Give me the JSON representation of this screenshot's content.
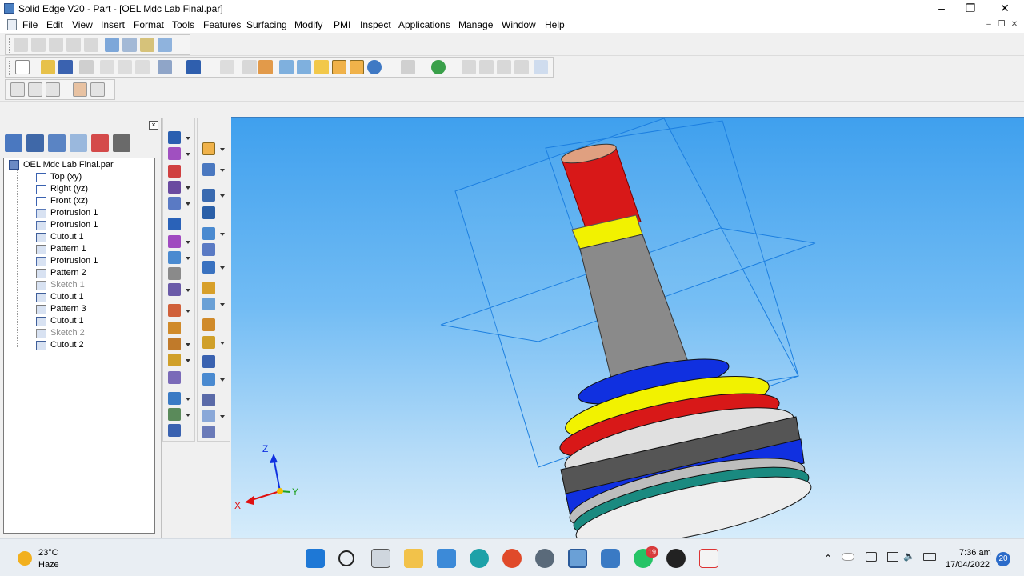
{
  "window": {
    "title": "Solid Edge V20 - Part - [OEL Mdc Lab Final.par]",
    "minimize_glyph": "–",
    "maximize_glyph": "❐",
    "close_glyph": "✕"
  },
  "menu": {
    "items": [
      "File",
      "Edit",
      "View",
      "Insert",
      "Format",
      "Tools",
      "Features",
      "Surfacing",
      "Modify",
      "PMI",
      "Inspect",
      "Applications",
      "Manage",
      "Window",
      "Help"
    ]
  },
  "pathfinder": {
    "close_glyph": "×",
    "root": "OEL Mdc Lab Final.par",
    "items": [
      {
        "label": "Top (xy)",
        "icon": "plane-icon",
        "muted": false
      },
      {
        "label": "Right (yz)",
        "icon": "plane-icon",
        "muted": false
      },
      {
        "label": "Front (xz)",
        "icon": "plane-icon",
        "muted": false
      },
      {
        "label": "Protrusion 1",
        "icon": "revolved-protrusion-icon",
        "muted": false
      },
      {
        "label": "Protrusion 1",
        "icon": "protrusion-icon",
        "muted": false
      },
      {
        "label": "Cutout 1",
        "icon": "cutout-icon",
        "muted": false
      },
      {
        "label": "Pattern 1",
        "icon": "pattern-icon",
        "muted": false
      },
      {
        "label": "Protrusion 1",
        "icon": "protrusion-icon",
        "muted": false
      },
      {
        "label": "Pattern 2",
        "icon": "pattern-icon",
        "muted": false
      },
      {
        "label": "Sketch 1",
        "icon": "sketch-icon",
        "muted": true
      },
      {
        "label": "Cutout 1",
        "icon": "cutout-icon",
        "muted": false
      },
      {
        "label": "Pattern 3",
        "icon": "pattern-icon",
        "muted": false
      },
      {
        "label": "Cutout 1",
        "icon": "cutout-icon",
        "muted": false
      },
      {
        "label": "Sketch 2",
        "icon": "sketch-icon",
        "muted": true
      },
      {
        "label": "Cutout 2",
        "icon": "cutout-icon",
        "muted": false
      }
    ]
  },
  "triad": {
    "z": "Z",
    "y": "Y",
    "x": "X"
  },
  "taskbar": {
    "weather_temp": "23°C",
    "weather_desc": "Haze",
    "time": "7:36 am",
    "date": "17/04/2022",
    "whatsapp_badge": "19",
    "notification_count": "20"
  },
  "colors": {
    "viewport_top": "#3fa0ee",
    "viewport_bottom": "#d6ecfb",
    "thread_red": "#d81818",
    "shaft_gray": "#8a8a8a",
    "yellow": "#f2f200",
    "blue": "#1030e0",
    "teal": "#1a8a80"
  }
}
